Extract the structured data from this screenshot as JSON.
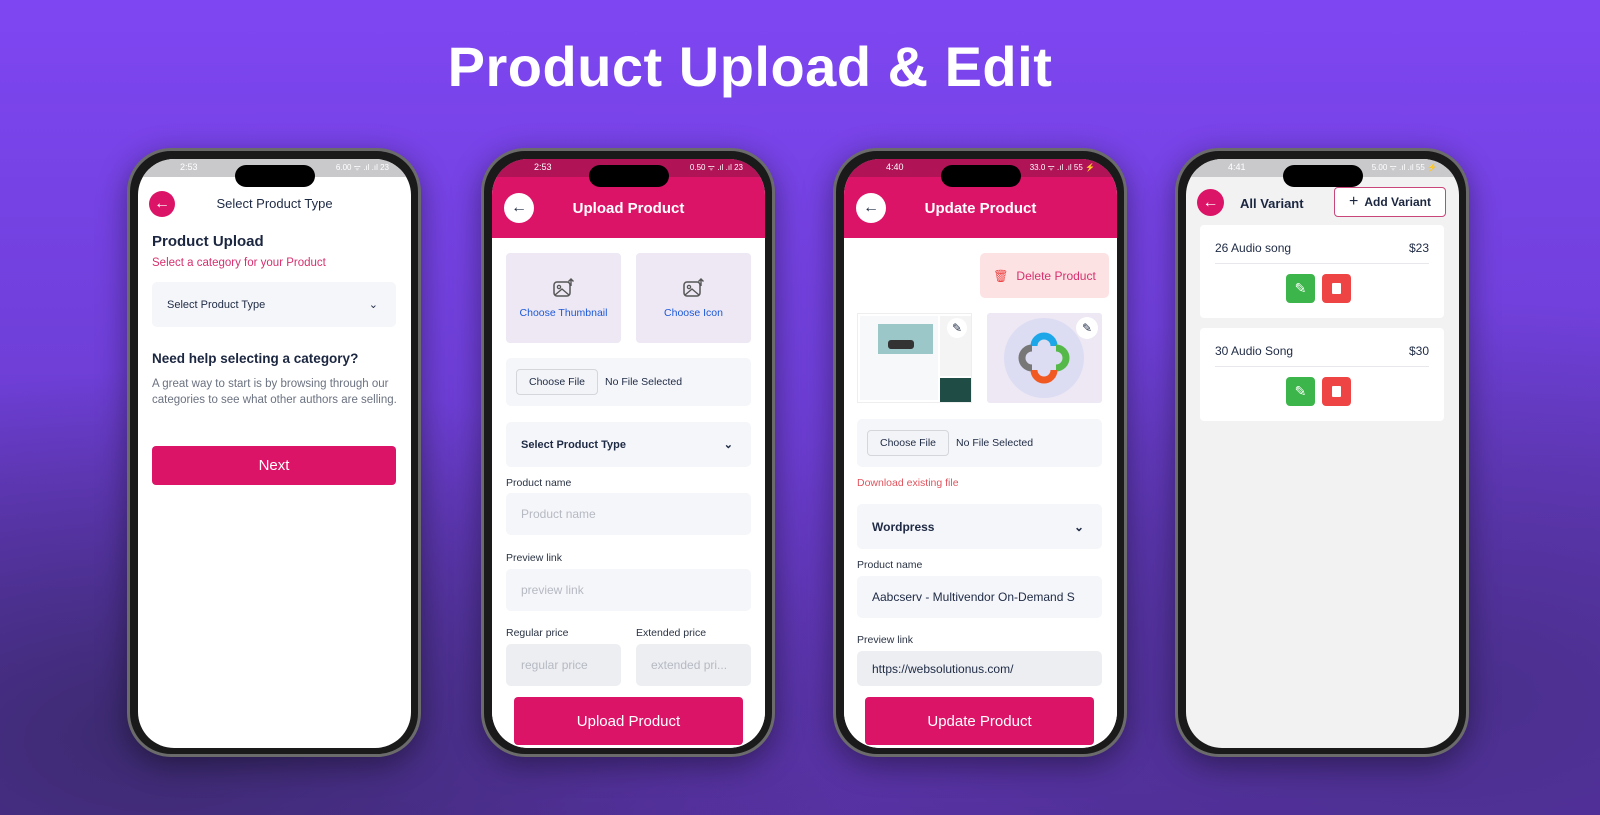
{
  "headline": "Product Upload & Edit",
  "colors": {
    "brand": "#dc1468",
    "edit": "#3cb54a",
    "delete": "#ef4444",
    "link": "#1d58d8"
  },
  "screen1": {
    "status_time": "2:53",
    "status_icons": "6.00 ᯤ .ıl .ıl 23",
    "back_icon": "arrow-left-icon",
    "title": "Select Product Type",
    "heading": "Product Upload",
    "subheading": "Select a category for your Product",
    "select": {
      "value": "Select Product Type",
      "icon": "chevron-down-icon"
    },
    "help_title": "Need help selecting a category?",
    "help_text": "A great way to start is by browsing through our categories to see what other authors are selling.",
    "next_label": "Next"
  },
  "screen2": {
    "status_time": "2:53",
    "status_icons": "0.50 ᯤ .ıl .ıl 23",
    "title": "Upload Product",
    "thumbnail_label": "Choose Thumbnail",
    "icon_label": "Choose Icon",
    "choose_file": "Choose File",
    "no_file": "No File Selected",
    "select_type": "Select Product Type",
    "product_name_label": "Product name",
    "product_name_placeholder": "Product name",
    "preview_label": "Preview link",
    "preview_placeholder": "preview link",
    "regular_label": "Regular price",
    "regular_placeholder": "regular price",
    "extended_label": "Extended price",
    "extended_placeholder": "extended pri...",
    "submit_label": "Upload Product"
  },
  "screen3": {
    "status_time": "4:40",
    "status_icons": "33.0 ᯤ .ıl .ıl 55 ⚡",
    "title": "Update Product",
    "delete_label": "Delete Product",
    "choose_file": "Choose File",
    "no_file": "No File Selected",
    "download_link": "Download existing file",
    "select_type": "Wordpress",
    "product_name_label": "Product name",
    "product_name_value": "Aabcserv - Multivendor On-Demand S",
    "preview_label": "Preview link",
    "preview_value": "https://websolutionus.com/",
    "submit_label": "Update Product"
  },
  "screen4": {
    "status_time": "4:41",
    "status_icons": "5.00 ᯤ .ıl .ıl 55 ⚡",
    "title": "All Variant",
    "add_label": "Add Variant",
    "variants": [
      {
        "name": "26 Audio song",
        "price": "$23"
      },
      {
        "name": "30 Audio Song",
        "price": "$30"
      }
    ]
  }
}
